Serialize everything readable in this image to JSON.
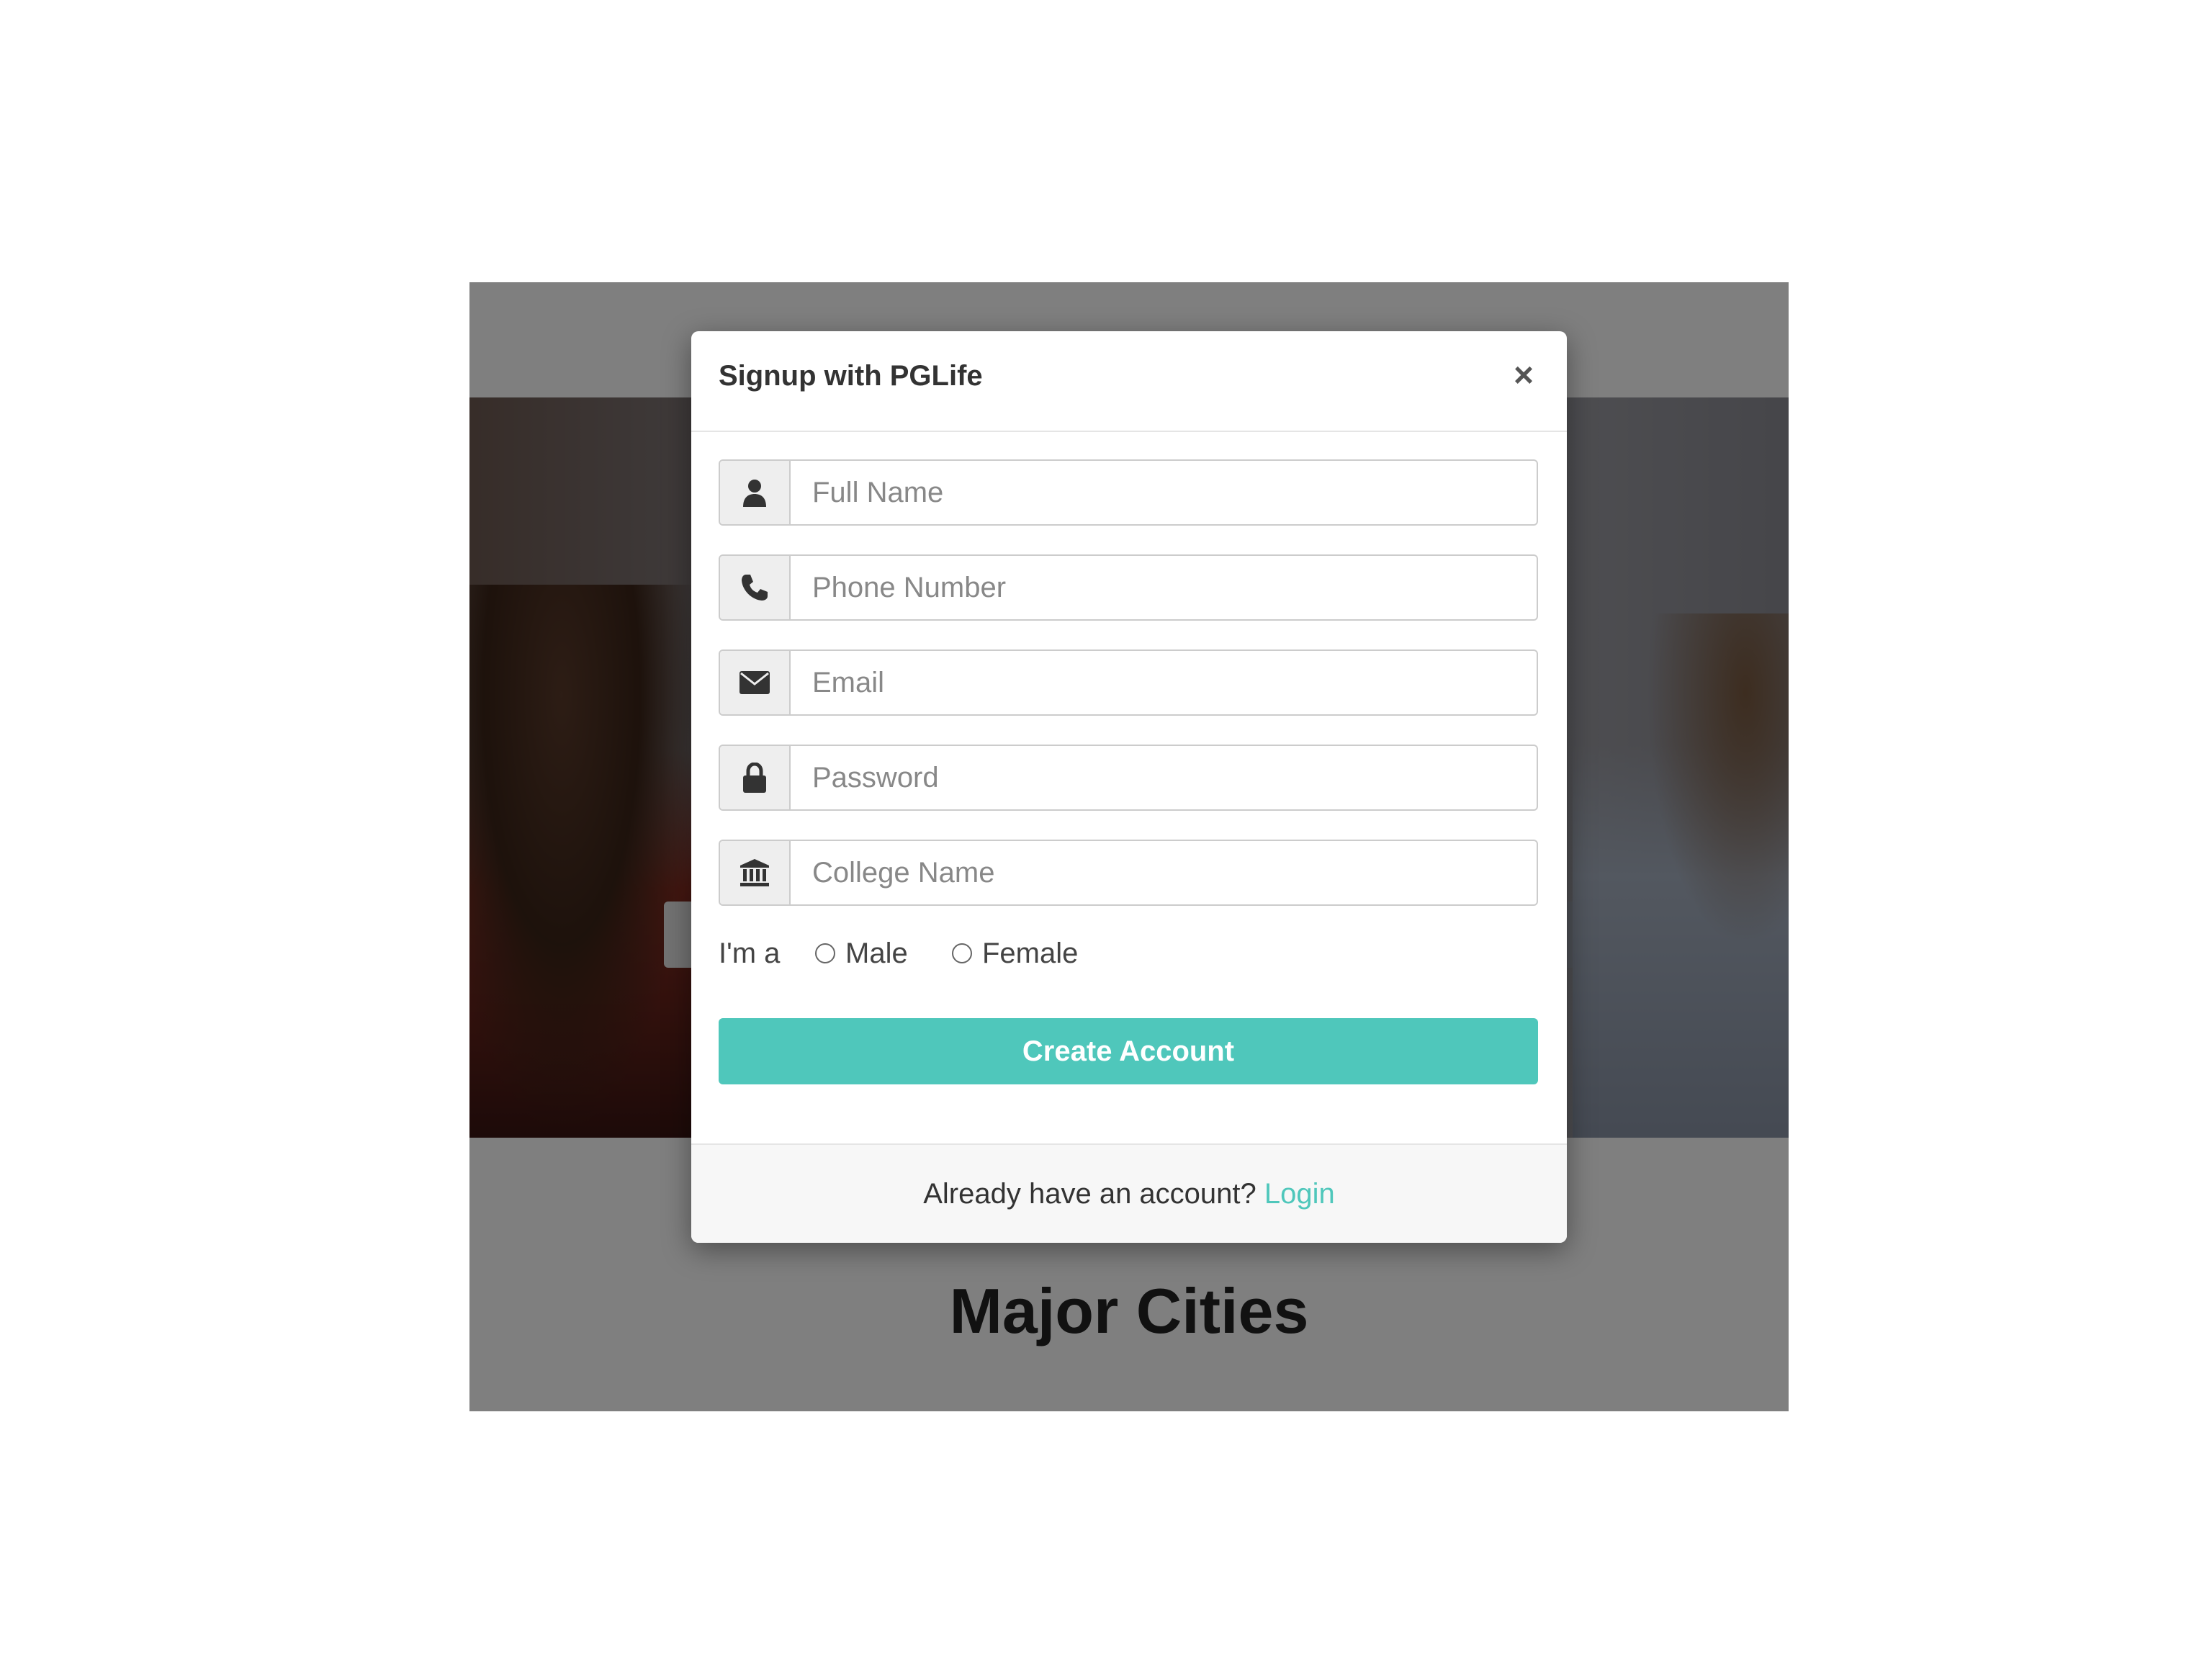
{
  "page": {
    "section_title": "Major Cities"
  },
  "modal": {
    "title": "Signup with PGLife",
    "close_label": "×",
    "fields": [
      {
        "name": "full-name",
        "placeholder": "Full Name",
        "icon": "user-icon"
      },
      {
        "name": "phone-number",
        "placeholder": "Phone Number",
        "icon": "phone-icon"
      },
      {
        "name": "email",
        "placeholder": "Email",
        "icon": "envelope-icon"
      },
      {
        "name": "password",
        "placeholder": "Password",
        "icon": "lock-icon"
      },
      {
        "name": "college-name",
        "placeholder": "College Name",
        "icon": "institution-icon"
      }
    ],
    "gender": {
      "label": "I'm a",
      "options": [
        "Male",
        "Female"
      ]
    },
    "submit_label": "Create Account",
    "footer": {
      "prompt": "Already have an account?",
      "login_label": "Login"
    }
  },
  "colors": {
    "accent": "#4fc7bb",
    "backdrop": "rgba(0,0,0,0.5)"
  }
}
